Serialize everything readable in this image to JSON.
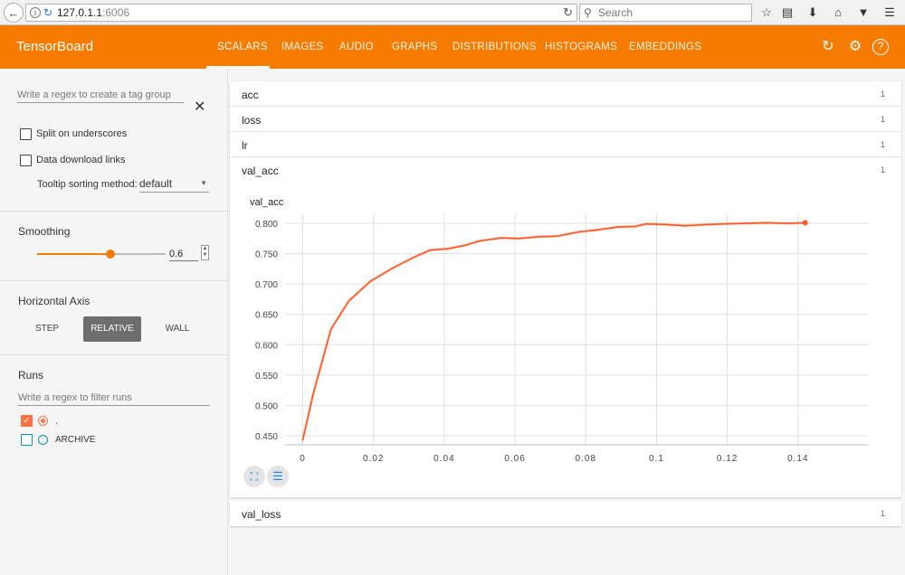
{
  "browser": {
    "url_host": "127.0.1.1",
    "url_port": ":6006",
    "search_placeholder": "Search",
    "icons": [
      "back-icon",
      "info-icon",
      "reload-icon",
      "search-icon",
      "star-icon",
      "reading-list-icon",
      "download-icon",
      "home-icon",
      "pocket-icon",
      "menu-icon"
    ]
  },
  "header": {
    "brand": "TensorBoard",
    "tabs": [
      "SCALARS",
      "IMAGES",
      "AUDIO",
      "GRAPHS",
      "DISTRIBUTIONS",
      "HISTOGRAMS",
      "EMBEDDINGS"
    ],
    "active_tab": "SCALARS",
    "accent_color": "#f57c00"
  },
  "sidebar": {
    "tag_regex_placeholder": "Write a regex to create a tag group",
    "split_underscores_label": "Split on underscores",
    "download_links_label": "Data download links",
    "tooltip_sort_label": "Tooltip sorting method:",
    "tooltip_sort_value": "default",
    "smoothing_title": "Smoothing",
    "smoothing_value": "0.6",
    "horizontal_axis_title": "Horizontal Axis",
    "axis_options": [
      "STEP",
      "RELATIVE",
      "WALL"
    ],
    "axis_selected": "RELATIVE",
    "runs_title": "Runs",
    "runs_regex_placeholder": "Write a regex to filter runs",
    "runs": [
      {
        "name": ".",
        "color": "#ff7043",
        "checked": true
      },
      {
        "name": "ARCHIVE",
        "color": "#0097a7",
        "checked": false
      }
    ]
  },
  "categories": [
    {
      "name": "acc",
      "count": "1"
    },
    {
      "name": "loss",
      "count": "1"
    },
    {
      "name": "lr",
      "count": "1"
    },
    {
      "name": "val_acc",
      "count": "1"
    }
  ],
  "bottom_category": {
    "name": "val_loss",
    "count": "1"
  },
  "chart_title": "val_acc",
  "chart_data": {
    "type": "line",
    "title": "val_acc",
    "xlabel": "",
    "ylabel": "",
    "xlim": [
      -0.005,
      0.16
    ],
    "ylim": [
      0.435,
      0.815
    ],
    "xticks": [
      0,
      0.02,
      0.04,
      0.06,
      0.08,
      0.1,
      0.12,
      0.14
    ],
    "xtick_labels": [
      "0",
      "0.02",
      "0.04",
      "0.06",
      "0.08",
      "0.1",
      "0.12",
      "0.14"
    ],
    "yticks": [
      0.45,
      0.5,
      0.55,
      0.6,
      0.65,
      0.7,
      0.75,
      0.8
    ],
    "ytick_labels": [
      "0.450",
      "0.500",
      "0.550",
      "0.600",
      "0.650",
      "0.700",
      "0.750",
      "0.800"
    ],
    "grid": true,
    "series": [
      {
        "color": "#ff5722",
        "x": [
          0.0,
          0.003,
          0.008,
          0.013,
          0.019,
          0.025,
          0.031,
          0.036,
          0.041,
          0.046,
          0.05,
          0.056,
          0.061,
          0.067,
          0.072,
          0.078,
          0.083,
          0.089,
          0.094,
          0.097,
          0.103,
          0.108,
          0.114,
          0.119,
          0.125,
          0.131,
          0.137,
          0.142
        ],
        "values": [
          0.443,
          0.52,
          0.626,
          0.672,
          0.704,
          0.725,
          0.743,
          0.756,
          0.758,
          0.764,
          0.771,
          0.776,
          0.775,
          0.778,
          0.779,
          0.786,
          0.789,
          0.794,
          0.795,
          0.799,
          0.798,
          0.796,
          0.798,
          0.799,
          0.8,
          0.801,
          0.8,
          0.801
        ]
      }
    ]
  }
}
